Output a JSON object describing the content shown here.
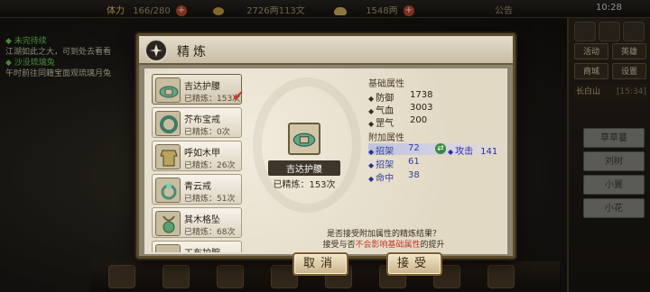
{
  "hud": {
    "stamina_label": "体力",
    "stamina_value": "166/280",
    "money": "2726两113文",
    "ingots": "1548两",
    "notice": "公告",
    "time": "10:28"
  },
  "quests": [
    {
      "title": "未完待续",
      "text": "江湖如此之大，可到处去看看"
    },
    {
      "title": "沙没琉璃兔",
      "text": "午时前往同籍宝面观琉璃月兔"
    }
  ],
  "right_menu": {
    "buttons": [
      "活动",
      "英雄",
      "商城",
      "设置"
    ],
    "location": "长白山",
    "location_time": "[15:34]",
    "side_items": [
      "草草蔓",
      "刘树",
      "小翼",
      "小花"
    ]
  },
  "dialog": {
    "title": "精炼",
    "items": [
      {
        "name": "吉达护腰",
        "count": "已精炼：153次",
        "selected": true
      },
      {
        "name": "芥布宝戒",
        "count": "已精炼：0次",
        "selected": false
      },
      {
        "name": "呼如木甲",
        "count": "已精炼：26次",
        "selected": false
      },
      {
        "name": "青云戒",
        "count": "已精炼：51次",
        "selected": false
      },
      {
        "name": "其木格坠",
        "count": "已精炼：68次",
        "selected": false
      },
      {
        "name": "工布护腕",
        "count": "",
        "selected": false
      }
    ],
    "preview": {
      "name": "吉达护腰",
      "count": "已精炼：153次"
    },
    "base_stats_title": "基础属性",
    "base_stats": [
      {
        "label": "防御",
        "value": "1738"
      },
      {
        "label": "气血",
        "value": "3003"
      },
      {
        "label": "罡气",
        "value": "200"
      }
    ],
    "extra_stats_title": "附加属性",
    "extra_stats": [
      {
        "label": "招架",
        "value": "72",
        "new_label": "攻击",
        "new_value": "141"
      },
      {
        "label": "招架",
        "value": "61"
      },
      {
        "label": "命中",
        "value": "38"
      }
    ],
    "prompt_line1": "是否接受附加属性的精炼结果？",
    "prompt_line2_a": "接受与否",
    "prompt_line2_b": "不会影响基础属性",
    "prompt_line2_c": "的提升",
    "cancel_label": "取消",
    "accept_label": "接受"
  },
  "colors": {
    "accent": "#c23a2a",
    "extra_stat": "#34409a",
    "positive_green": "#3a8a3a"
  }
}
